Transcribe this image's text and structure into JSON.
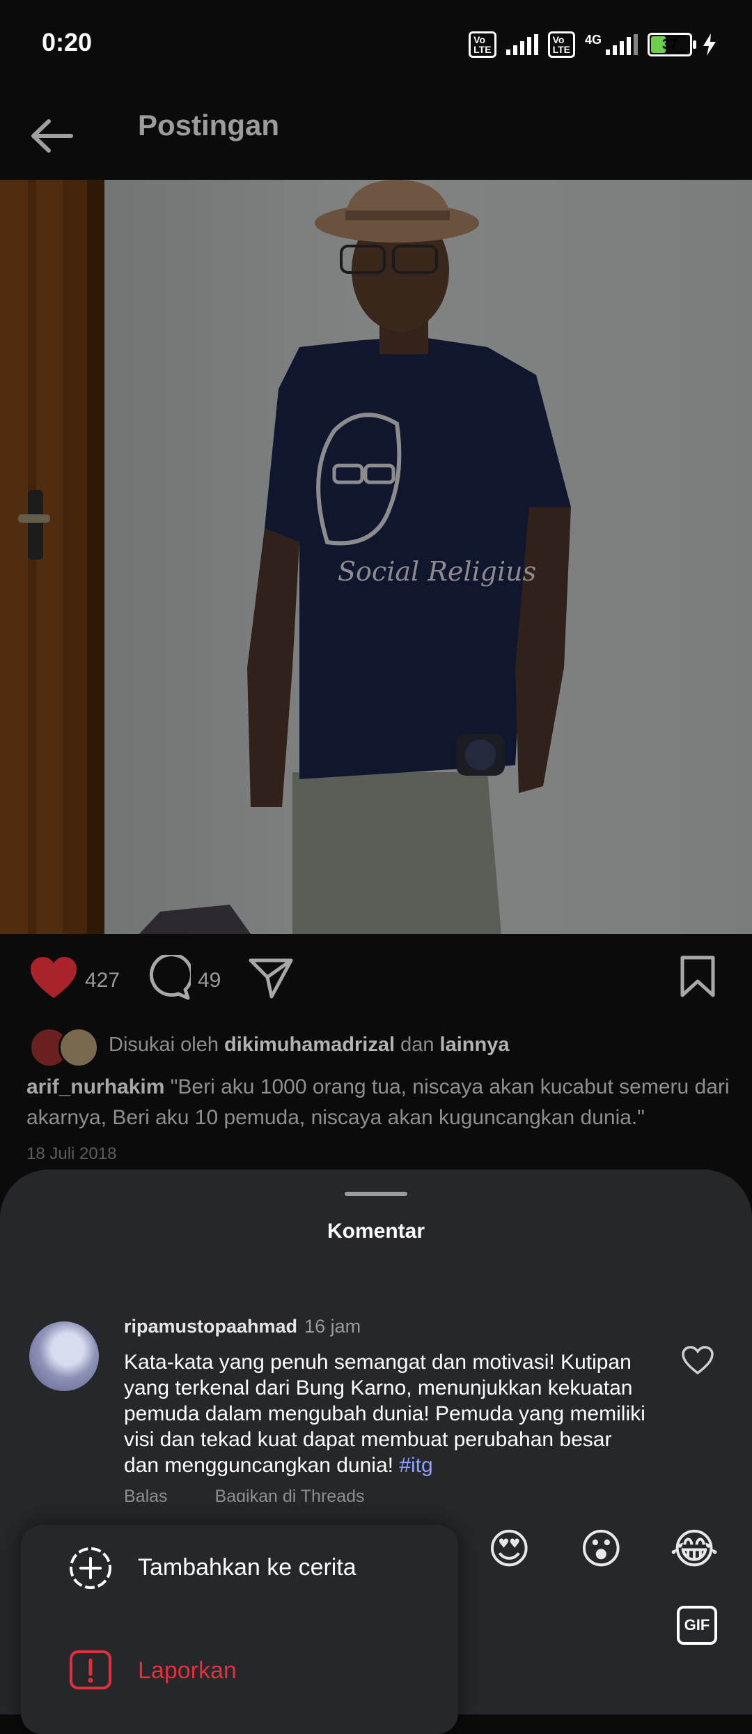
{
  "status_bar": {
    "time": "0:20",
    "sim1_label": "Vo LTE",
    "sim2_label": "Vo LTE",
    "network_type": "4G",
    "battery_level": "37",
    "charging": true,
    "battery_color": "#6fcf4b"
  },
  "header": {
    "title": "Postingan",
    "back_icon": "arrow-left-icon"
  },
  "post": {
    "likes_count": "427",
    "comments_count": "49",
    "liked": true,
    "like_color": "#e0303a",
    "liked_by_prefix": "Disukai oleh",
    "liked_by_user": "dikimuhamadrizal",
    "liked_by_joiner": "dan",
    "liked_by_others": "lainnya",
    "caption_user": "arif_nurhakim",
    "caption_text": "\"Beri aku 1000 orang tua, niscaya akan kucabut semeru dari akarnya, Beri aku 10 pemuda, niscaya akan kuguncangkan dunia.\"",
    "date": "18 Juli 2018",
    "shirt_print": "Social Religius"
  },
  "comments_sheet": {
    "title": "Komentar",
    "comment": {
      "username": "ripamustopaahmad",
      "time": "16 jam",
      "text": "Kata-kata yang penuh semangat dan motivasi! Kutipan yang terkenal dari Bung Karno, menunjukkan kekuatan pemuda dalam mengubah dunia!  Pemuda yang memiliki visi dan tekad kuat dapat membuat perubahan besar dan mengguncangkan dunia!",
      "hashtag": "#itg",
      "reply_label": "Balas",
      "share_label": "Bagikan di Threads"
    },
    "emojis": [
      "😍",
      "😮",
      "😂"
    ],
    "gif_label": "GIF",
    "hashtag_color": "#8fa0ff"
  },
  "menu": {
    "items": [
      {
        "label": "Tambahkan ke cerita",
        "icon": "add-circle-icon",
        "color": "#ffffff"
      },
      {
        "label": "Laporkan",
        "icon": "report-icon",
        "color": "#e0303a"
      }
    ]
  }
}
